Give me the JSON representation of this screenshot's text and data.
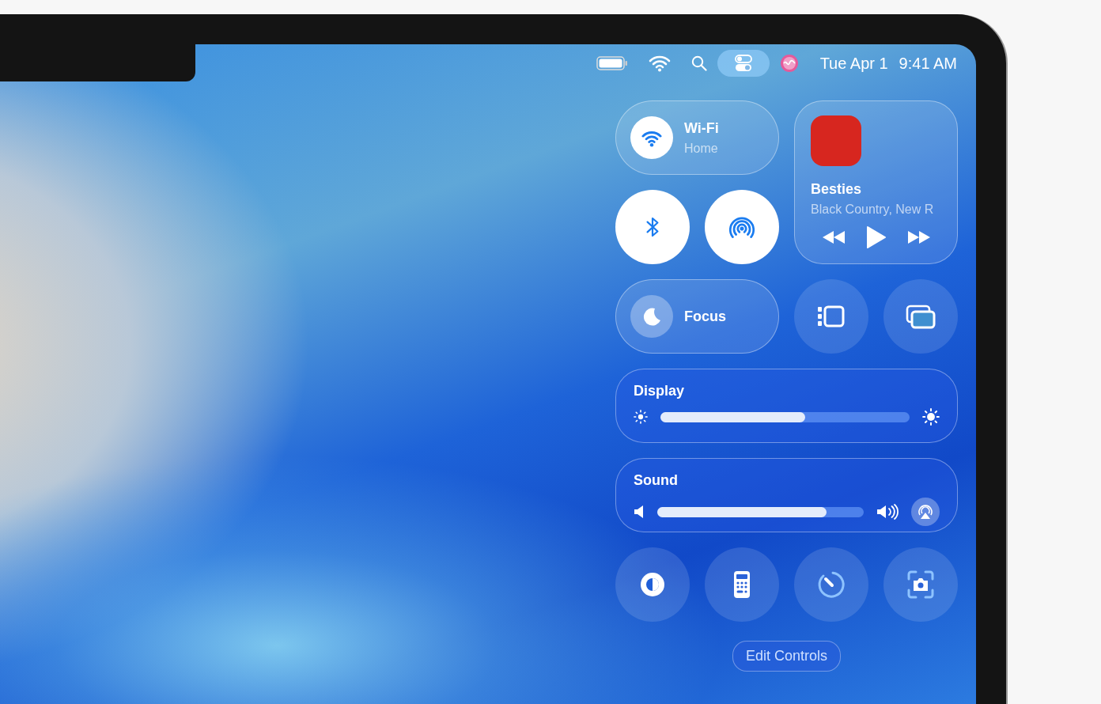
{
  "menu_bar": {
    "items": [
      {
        "kind": "battery",
        "selected": false
      },
      {
        "kind": "wifi",
        "selected": false
      },
      {
        "kind": "search",
        "selected": false
      },
      {
        "kind": "control-center",
        "selected": true
      },
      {
        "kind": "siri",
        "selected": false
      }
    ],
    "date": "Tue Apr 1",
    "time": "9:41 AM"
  },
  "control_center": {
    "wifi": {
      "title": "Wi-Fi",
      "subtitle": "Home",
      "on": true
    },
    "toggles": [
      {
        "kind": "bluetooth",
        "on": true
      },
      {
        "kind": "airdrop",
        "on": true
      }
    ],
    "now_playing": {
      "title": "Besties",
      "artist": "Black Country, New R"
    },
    "focus": {
      "label": "Focus",
      "on": false
    },
    "tiles": [
      {
        "kind": "stage-manager"
      },
      {
        "kind": "screen-mirroring"
      }
    ],
    "sliders": [
      {
        "kind": "display",
        "title": "Display",
        "level": 0.58
      },
      {
        "kind": "sound",
        "title": "Sound",
        "level": 0.82
      }
    ],
    "buttons": [
      {
        "kind": "dark-mode"
      },
      {
        "kind": "calculator"
      },
      {
        "kind": "timer"
      },
      {
        "kind": "screen-capture"
      }
    ],
    "edit_button": "Edit Controls"
  }
}
